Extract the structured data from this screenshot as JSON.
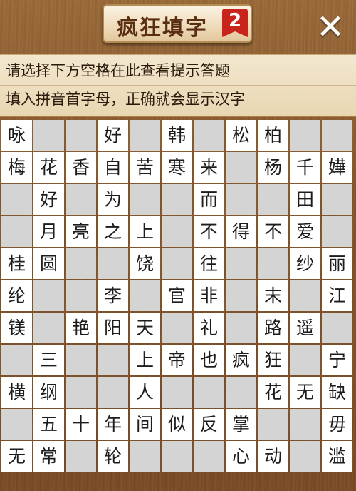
{
  "header": {
    "title": "疯狂填字",
    "level": "2",
    "close_label": "✕"
  },
  "hint": {
    "line1": "请选择下方空格在此查看提示答题",
    "line2": "填入拼音首字母，正确就会显示汉字"
  },
  "colors": {
    "wood": "#86552a",
    "blank_cell": "#d4d4d4",
    "filled_cell": "#ffffff",
    "badge": "#c9241b"
  },
  "grid": {
    "rows": [
      [
        "咏",
        "",
        "",
        "好",
        "",
        "韩",
        "",
        "松",
        "柏",
        "",
        ""
      ],
      [
        "梅",
        "花",
        "香",
        "自",
        "苦",
        "寒",
        "来",
        "",
        "杨",
        "千",
        "嬅"
      ],
      [
        "",
        "好",
        "",
        "为",
        "",
        "",
        "而",
        "",
        "",
        "田",
        ""
      ],
      [
        "",
        "月",
        "亮",
        "之",
        "上",
        "",
        "不",
        "得",
        "不",
        "爱",
        ""
      ],
      [
        "桂",
        "圆",
        "",
        "",
        "饶",
        "",
        "往",
        "",
        "",
        "纱",
        "丽"
      ],
      [
        "纶",
        "",
        "",
        "李",
        "",
        "官",
        "非",
        "",
        "末",
        "",
        "江"
      ],
      [
        "镁",
        "",
        "艳",
        "阳",
        "天",
        "",
        "礼",
        "",
        "路",
        "遥",
        ""
      ],
      [
        "",
        "三",
        "",
        "",
        "上",
        "帝",
        "也",
        "疯",
        "狂",
        "",
        "宁"
      ],
      [
        "横",
        "纲",
        "",
        "",
        "人",
        "",
        "",
        "",
        "花",
        "无",
        "缺"
      ],
      [
        "",
        "五",
        "十",
        "年",
        "间",
        "似",
        "反",
        "掌",
        "",
        "",
        "毋"
      ],
      [
        "无",
        "常",
        "",
        "轮",
        "",
        "",
        "",
        "心",
        "动",
        "",
        "滥"
      ]
    ]
  }
}
